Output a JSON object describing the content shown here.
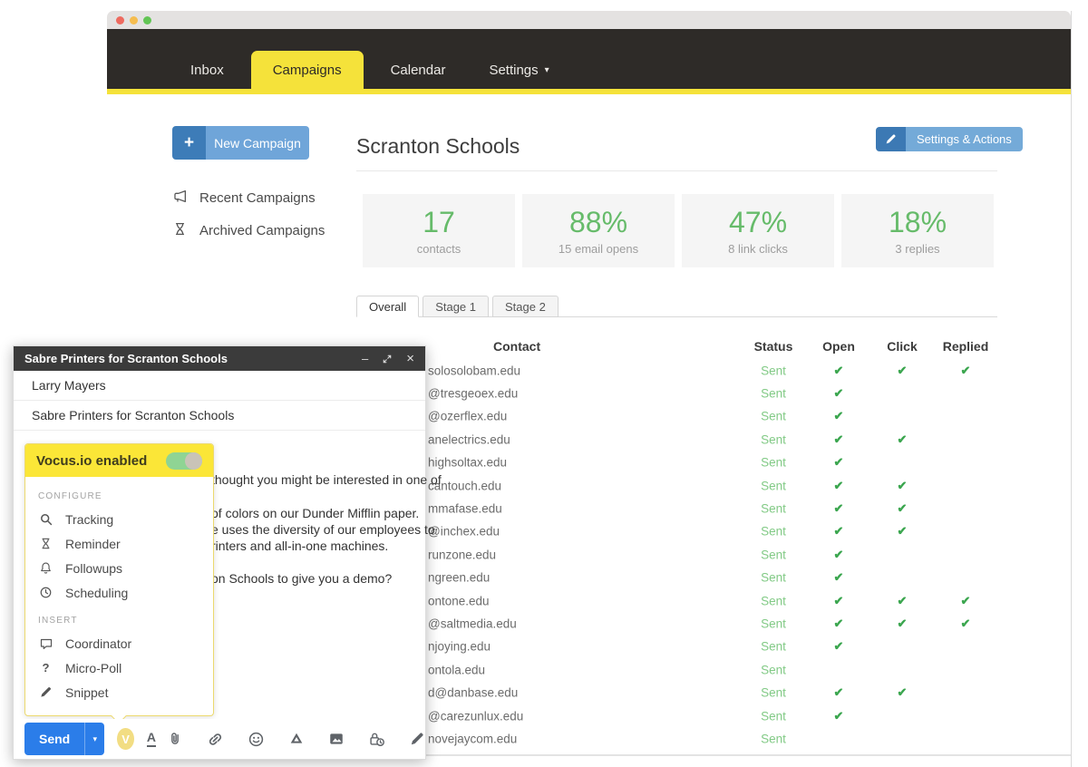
{
  "nav": {
    "items": [
      {
        "label": "Inbox"
      },
      {
        "label": "Campaigns"
      },
      {
        "label": "Calendar"
      },
      {
        "label": "Settings"
      }
    ],
    "active": "Campaigns"
  },
  "sidebar": {
    "new_campaign_label": "New Campaign",
    "items": [
      {
        "label": "Recent Campaigns",
        "icon": "megaphone-icon"
      },
      {
        "label": "Archived Campaigns",
        "icon": "hourglass-icon"
      }
    ]
  },
  "campaign": {
    "title": "Scranton Schools",
    "settings_actions_label": "Settings & Actions",
    "stats": [
      {
        "value": "17",
        "label": "contacts"
      },
      {
        "value": "88%",
        "label": "15 email opens"
      },
      {
        "value": "47%",
        "label": "8 link clicks"
      },
      {
        "value": "18%",
        "label": "3 replies"
      }
    ],
    "tabs": [
      "Overall",
      "Stage 1",
      "Stage 2"
    ],
    "active_tab": "Overall"
  },
  "table": {
    "columns": [
      "Contact",
      "Status",
      "Open",
      "Click",
      "Replied"
    ],
    "check_glyph": "✔",
    "rows": [
      {
        "email": "solosolobam.edu",
        "status": "Sent",
        "open": true,
        "click": true,
        "replied": true
      },
      {
        "email": "@tresgeoex.edu",
        "status": "Sent",
        "open": true,
        "click": false,
        "replied": false
      },
      {
        "email": "@ozerflex.edu",
        "status": "Sent",
        "open": true,
        "click": false,
        "replied": false
      },
      {
        "email": "anelectrics.edu",
        "status": "Sent",
        "open": true,
        "click": true,
        "replied": false
      },
      {
        "email": "highsoltax.edu",
        "status": "Sent",
        "open": true,
        "click": false,
        "replied": false
      },
      {
        "email": "cantouch.edu",
        "status": "Sent",
        "open": true,
        "click": true,
        "replied": false
      },
      {
        "email": "mmafase.edu",
        "status": "Sent",
        "open": true,
        "click": true,
        "replied": false
      },
      {
        "email": "@inchex.edu",
        "status": "Sent",
        "open": true,
        "click": true,
        "replied": false
      },
      {
        "email": "runzone.edu",
        "status": "Sent",
        "open": true,
        "click": false,
        "replied": false
      },
      {
        "email": "ngreen.edu",
        "status": "Sent",
        "open": true,
        "click": false,
        "replied": false
      },
      {
        "email": "ontone.edu",
        "status": "Sent",
        "open": true,
        "click": true,
        "replied": true
      },
      {
        "email": "@saltmedia.edu",
        "status": "Sent",
        "open": true,
        "click": true,
        "replied": true
      },
      {
        "email": "njoying.edu",
        "status": "Sent",
        "open": true,
        "click": false,
        "replied": false
      },
      {
        "email": "ontola.edu",
        "status": "Sent",
        "open": false,
        "click": false,
        "replied": false
      },
      {
        "email": "d@danbase.edu",
        "status": "Sent",
        "open": true,
        "click": true,
        "replied": false
      },
      {
        "email": "@carezunlux.edu",
        "status": "Sent",
        "open": true,
        "click": false,
        "replied": false
      },
      {
        "email": "novejaycom.edu",
        "status": "Sent",
        "open": false,
        "click": false,
        "replied": false
      }
    ]
  },
  "compose": {
    "title": "Sabre Printers for Scranton Schools",
    "recipient": "Larry Mayers",
    "subject": "Sabre Printers for Scranton Schools",
    "body_fragments": [
      "thought you might be interested in one of",
      "of colors on our Dunder Mifflin paper.",
      "e uses the diversity of our employees to",
      "rinters and all-in-one machines.",
      "on Schools to give you a demo?"
    ],
    "vocus": {
      "header": "Vocus.io enabled",
      "toggle_on": true,
      "badge": "V",
      "configure_label": "CONFIGURE",
      "configure_items": [
        {
          "label": "Tracking",
          "icon": "magnifier-icon"
        },
        {
          "label": "Reminder",
          "icon": "hourglass-icon"
        },
        {
          "label": "Followups",
          "icon": "bell-icon"
        },
        {
          "label": "Scheduling",
          "icon": "clock-icon"
        }
      ],
      "insert_label": "INSERT",
      "insert_items": [
        {
          "label": "Coordinator",
          "icon": "speech-bubble-icon"
        },
        {
          "label": "Micro-Poll",
          "icon": "question-mark-icon"
        },
        {
          "label": "Snippet",
          "icon": "pencil-icon"
        }
      ]
    },
    "send_label": "Send"
  },
  "colors": {
    "accent_yellow": "#f5e23a",
    "nav_dark": "#2e2b28",
    "send_blue": "#2b7de9",
    "stat_green": "#66bb6a",
    "check_green": "#3ba64f",
    "sent_green": "#82ca86",
    "button_blue_dark": "#3d7cb8",
    "button_blue_light": "#6fa5d9"
  }
}
